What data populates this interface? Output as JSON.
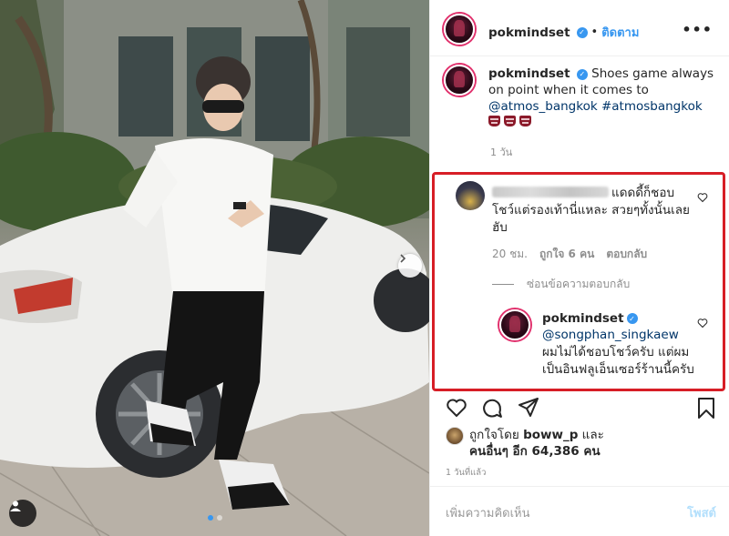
{
  "post": {
    "username": "pokmindset",
    "verified_mark": "✓",
    "separator": "•",
    "follow_label": "ติดตาม",
    "more_label": "•••",
    "caption_text": "Shoes game always on point when it comes to",
    "caption_mention": "@atmos_bangkok",
    "caption_hashtag": "#atmosbangkok",
    "caption_emoji": "men-with-bunny-ears-emoji",
    "caption_time": "1 วัน"
  },
  "comment": {
    "username_redacted": true,
    "text": "แดดดี้ก็ชอบโชว์แต่รองเท้านี่แหละ สวยๆทั้งนั้นเลยฮับ",
    "time": "20 ชม.",
    "likes": "ถูกใจ 6 คน",
    "reply_label": "ตอบกลับ",
    "hide_replies_label": "ซ่อนข้อความตอบกลับ"
  },
  "reply": {
    "username": "pokmindset",
    "mention": "@songphan_singkaew",
    "text": "ผมไม่ได้ชอบโชว์ครับ แต่ผมเป็นอินฟลูเอ็นเซอร์ร้านนี้ครับ"
  },
  "likes": {
    "prefix": "ถูกใจโดย",
    "user": "boww_p",
    "and": "และ",
    "others": "คนอื่นๆ อีก 64,386 คน"
  },
  "post_time": "1 วันที่แล้ว",
  "add_comment": {
    "placeholder": "เพิ่มความคิดเห็น",
    "post_label": "โพสต์"
  },
  "colors": {
    "accent_blue": "#3897f0",
    "highlight_red": "#d71e26",
    "link_dark": "#003569"
  },
  "icons": {
    "like": "heart-icon",
    "comment": "comment-bubble-icon",
    "share": "paper-plane-icon",
    "save": "bookmark-icon",
    "carousel_next": "chevron-right-icon"
  }
}
